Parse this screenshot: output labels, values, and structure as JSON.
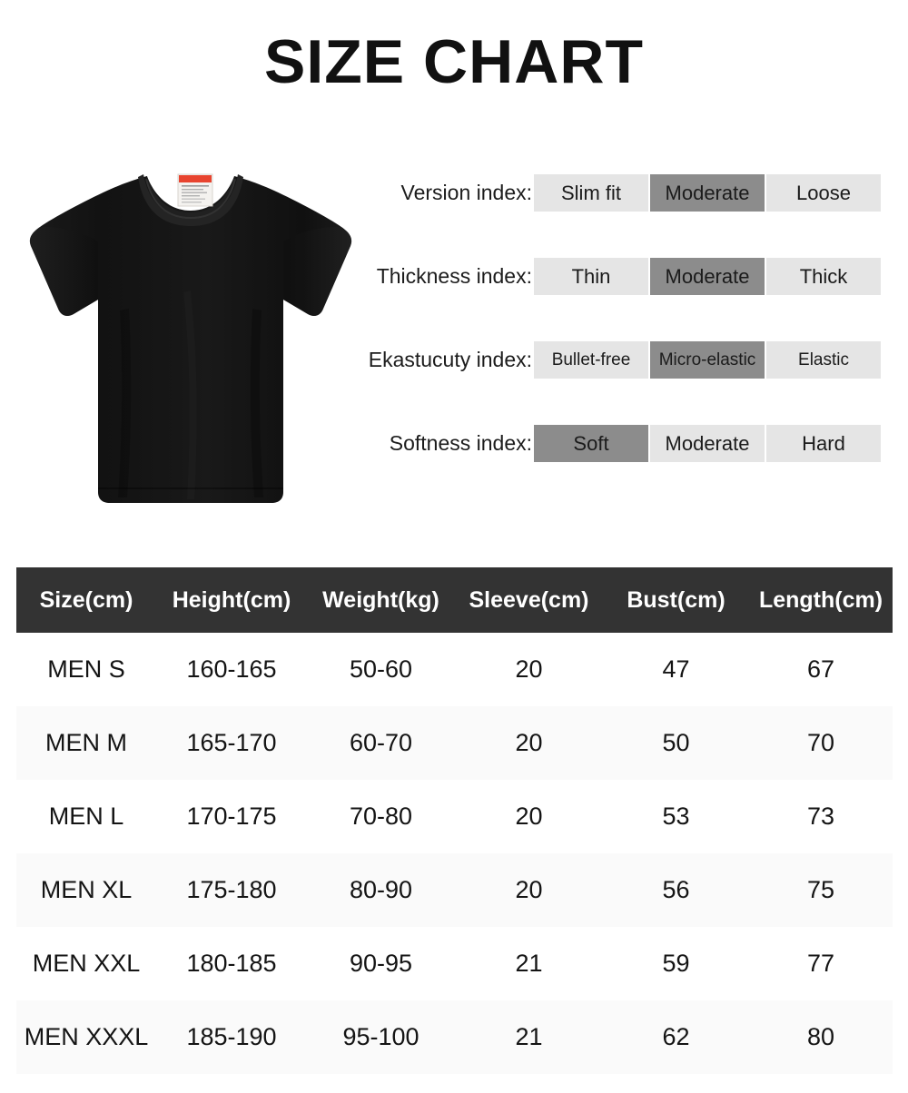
{
  "title": "SIZE CHART",
  "product": {
    "icon": "tshirt-photo",
    "description": "black short sleeve crew neck t-shirt",
    "label": {
      "icon": "care-label",
      "band_color": "#e8442f"
    },
    "color": "#141414"
  },
  "colors": {
    "chip_off": "#e5e5e5",
    "chip_on": "#8c8c8c",
    "header_bg": "#333333",
    "row_alt": "#fafafa",
    "text": "#111111"
  },
  "indexes": [
    {
      "label": "Version index:",
      "options": [
        {
          "text": "Slim fit",
          "selected": false
        },
        {
          "text": "Moderate",
          "selected": true
        },
        {
          "text": "Loose",
          "selected": false
        }
      ]
    },
    {
      "label": "Thickness index:",
      "options": [
        {
          "text": "Thin",
          "selected": false
        },
        {
          "text": "Moderate",
          "selected": true
        },
        {
          "text": "Thick",
          "selected": false
        }
      ]
    },
    {
      "label": "Ekastucuty index:",
      "options": [
        {
          "text": "Bullet-free",
          "selected": false
        },
        {
          "text": "Micro-elastic",
          "selected": true
        },
        {
          "text": "Elastic",
          "selected": false
        }
      ]
    },
    {
      "label": "Softness index:",
      "options": [
        {
          "text": "Soft",
          "selected": true
        },
        {
          "text": "Moderate",
          "selected": false
        },
        {
          "text": "Hard",
          "selected": false
        }
      ]
    }
  ],
  "table": {
    "headers": [
      "Size(cm)",
      "Height(cm)",
      "Weight(kg)",
      "Sleeve(cm)",
      "Bust(cm)",
      "Length(cm)"
    ],
    "rows": [
      [
        "MEN S",
        "160-165",
        "50-60",
        "20",
        "47",
        "67"
      ],
      [
        "MEN M",
        "165-170",
        "60-70",
        "20",
        "50",
        "70"
      ],
      [
        "MEN L",
        "170-175",
        "70-80",
        "20",
        "53",
        "73"
      ],
      [
        "MEN XL",
        "175-180",
        "80-90",
        "20",
        "56",
        "75"
      ],
      [
        "MEN XXL",
        "180-185",
        "90-95",
        "21",
        "59",
        "77"
      ],
      [
        "MEN XXXL",
        "185-190",
        "95-100",
        "21",
        "62",
        "80"
      ]
    ]
  }
}
